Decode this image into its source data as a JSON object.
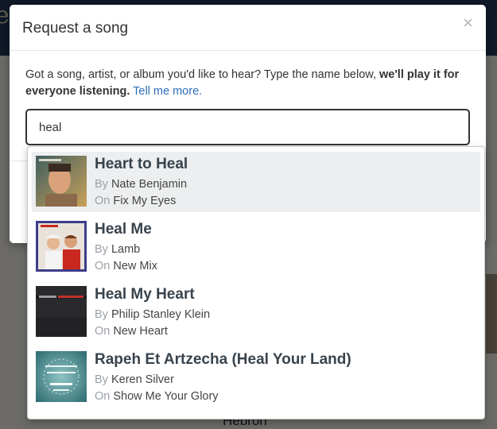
{
  "modal": {
    "title": "Request a song",
    "close_glyph": "×",
    "intro_text": "Got a song, artist, or album you'd like to hear? Type the name below, ",
    "intro_bold": "we'll play it for everyone listening.",
    "intro_link": "Tell me more.",
    "search_value": "heal"
  },
  "dropdown": {
    "by_prefix": "By",
    "on_prefix": "On",
    "results": [
      {
        "title": "Heart to Heal",
        "artist": "Nate Benjamin",
        "album": "Fix My Eyes",
        "active": true
      },
      {
        "title": "Heal Me",
        "artist": "Lamb",
        "album": "New Mix",
        "active": false
      },
      {
        "title": "Heal My Heart",
        "artist": "Philip Stanley Klein",
        "album": "New Heart",
        "active": false
      },
      {
        "title": "Rapeh Et Artzecha (Heal Your Land)",
        "artist": "Keren Silver",
        "album": "Show Me Your Glory",
        "active": false
      }
    ]
  },
  "background": {
    "footer_text": "Hebron"
  },
  "colors": {
    "link": "#2c6dba",
    "active_row": "#eceeef",
    "title_text": "#38434d",
    "prefix_text": "#9aa0a6"
  }
}
